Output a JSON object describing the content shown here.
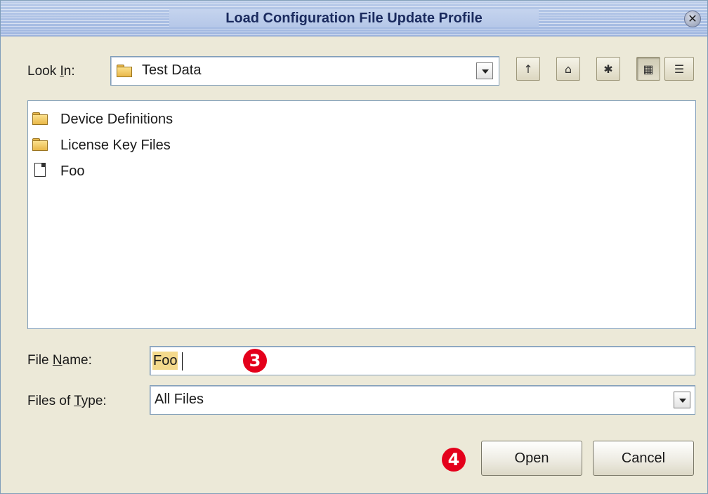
{
  "dialog": {
    "title": "Load Configuration File Update Profile",
    "close_icon": "close-icon"
  },
  "look_in": {
    "label_pre": "Look ",
    "label_mn": "I",
    "label_post": "n:",
    "value": "Test Data",
    "icon": "folder-icon"
  },
  "toolbar": [
    {
      "name": "up-one-level-icon",
      "glyph": "↑"
    },
    {
      "name": "home-icon",
      "glyph": "⌂"
    },
    {
      "name": "new-folder-icon",
      "glyph": "✱"
    },
    {
      "name": "list-view-icon",
      "glyph": "▦"
    },
    {
      "name": "details-view-icon",
      "glyph": "☰"
    }
  ],
  "files": [
    {
      "name": "Device Definitions",
      "type": "folder"
    },
    {
      "name": "License Key Files",
      "type": "folder"
    },
    {
      "name": "Foo",
      "type": "file"
    }
  ],
  "file_name": {
    "label_pre": "File ",
    "label_mn": "N",
    "label_post": "ame:",
    "value": "Foo"
  },
  "files_of_type": {
    "label_pre": "Files of ",
    "label_mn": "T",
    "label_post": "ype:",
    "value": "All Files"
  },
  "callouts": {
    "step3": "3",
    "step4": "4"
  },
  "buttons": {
    "open": "Open",
    "cancel": "Cancel"
  },
  "colors": {
    "dialog_bg": "#ece9d8",
    "titlebar": "#b9cbe9",
    "callout": "#e4001b",
    "selection": "#f4d98c"
  }
}
